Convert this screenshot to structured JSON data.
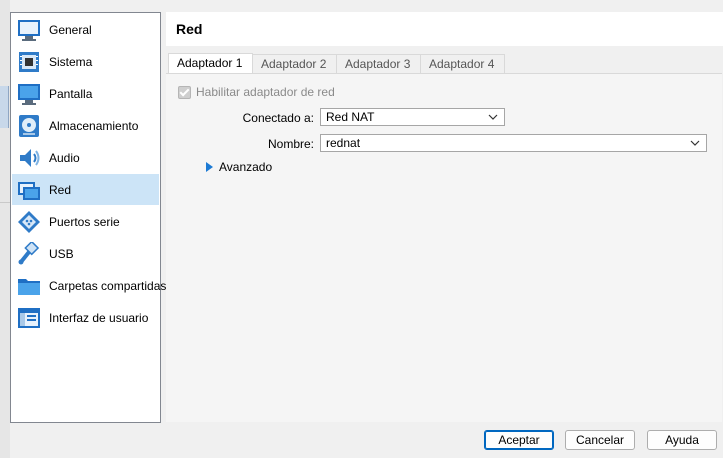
{
  "sidebar": {
    "items": [
      {
        "label": "General",
        "icon": "monitor-general-icon"
      },
      {
        "label": "Sistema",
        "icon": "chip-icon"
      },
      {
        "label": "Pantalla",
        "icon": "display-icon"
      },
      {
        "label": "Almacenamiento",
        "icon": "storage-disc-icon"
      },
      {
        "label": "Audio",
        "icon": "speaker-icon"
      },
      {
        "label": "Red",
        "icon": "network-icon",
        "selected": true
      },
      {
        "label": "Puertos serie",
        "icon": "serial-port-icon"
      },
      {
        "label": "USB",
        "icon": "usb-icon"
      },
      {
        "label": "Carpetas compartidas",
        "icon": "folder-icon"
      },
      {
        "label": "Interfaz de usuario",
        "icon": "ui-window-icon"
      }
    ]
  },
  "header": {
    "title": "Red"
  },
  "tabs": [
    {
      "label": "Adaptador 1",
      "active": true
    },
    {
      "label": "Adaptador 2"
    },
    {
      "label": "Adaptador 3"
    },
    {
      "label": "Adaptador 4"
    }
  ],
  "adapter": {
    "enable_label": "Habilitar adaptador de red",
    "enabled": true,
    "connected_label": "Conectado a:",
    "connected_value": "Red NAT",
    "name_label": "Nombre:",
    "name_value": "rednat",
    "advanced_label": "Avanzado"
  },
  "buttons": {
    "accept": "Aceptar",
    "cancel": "Cancelar",
    "help": "Ayuda"
  },
  "colors": {
    "selection": "#cce4f7",
    "accent": "#0067c0",
    "expander": "#1c7ad4"
  }
}
